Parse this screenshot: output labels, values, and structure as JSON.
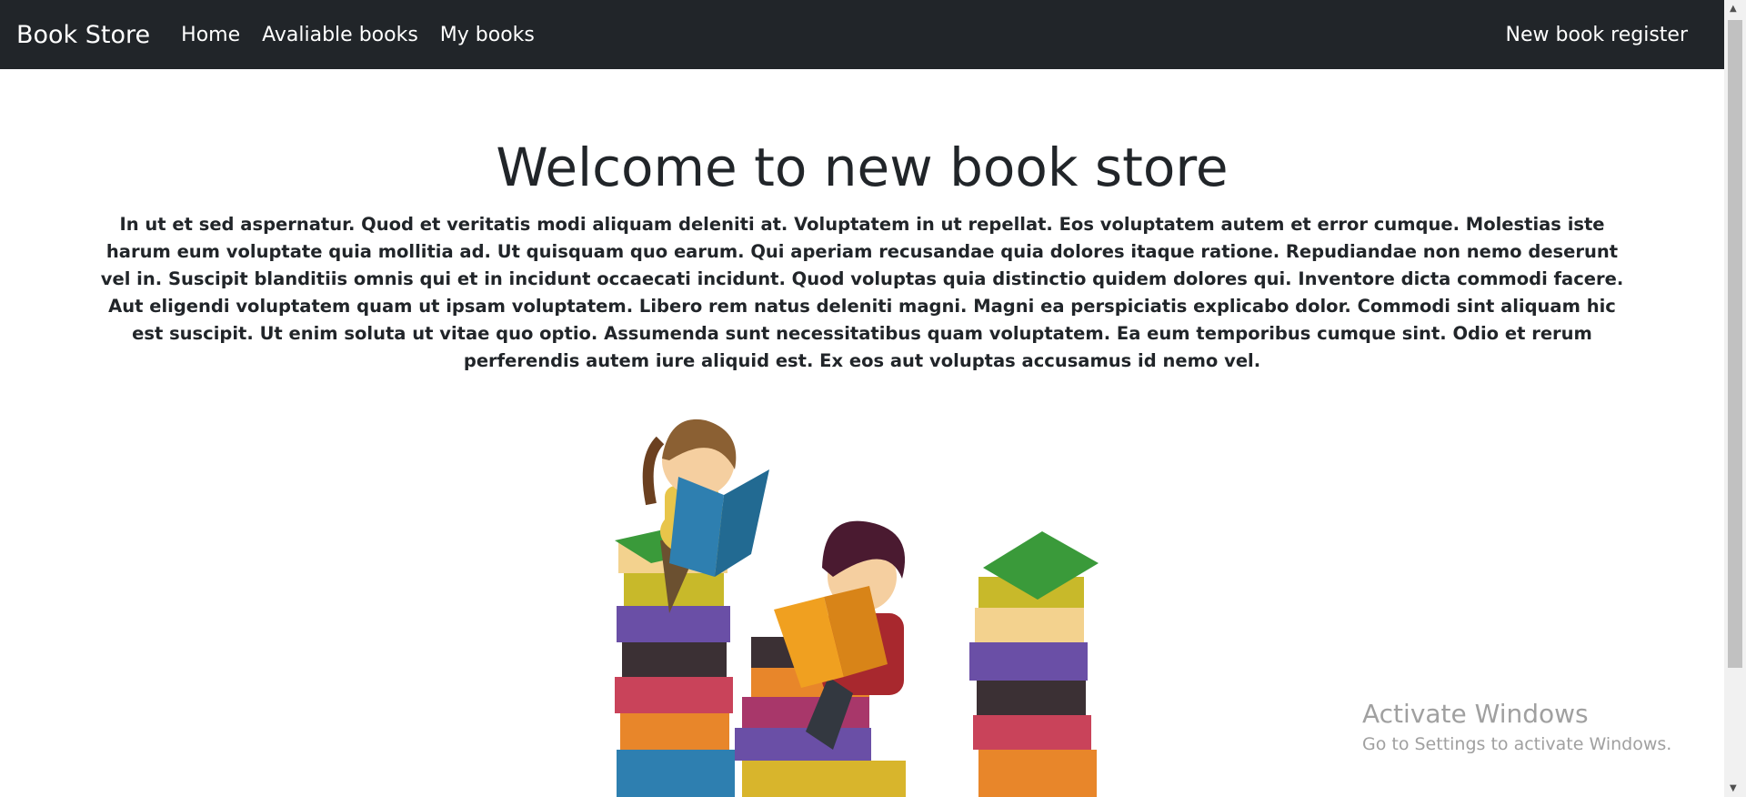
{
  "navbar": {
    "brand": "Book Store",
    "links": [
      {
        "label": "Home"
      },
      {
        "label": "Avaliable books"
      },
      {
        "label": "My books"
      }
    ],
    "register": "New book register"
  },
  "main": {
    "title": "Welcome to new book store",
    "paragraph": "In ut et sed aspernatur. Quod et veritatis modi aliquam deleniti at. Voluptatem in ut repellat. Eos voluptatem autem et error cumque. Molestias iste harum eum voluptate quia mollitia ad. Ut quisquam quo earum. Qui aperiam recusandae quia dolores itaque ratione. Repudiandae non nemo deserunt vel in. Suscipit blanditiis omnis qui et in incidunt occaecati incidunt. Quod voluptas quia distinctio quidem dolores qui. Inventore dicta commodi facere. Aut eligendi voluptatem quam ut ipsam voluptatem. Libero rem natus deleniti magni. Magni ea perspiciatis explicabo dolor. Commodi sint aliquam hic est suscipit. Ut enim soluta ut vitae quo optio. Assumenda sunt necessitatibus quam voluptatem. Ea eum temporibus cumque sint. Odio et rerum perferendis autem iure aliquid est. Ex eos aut voluptas accusamus id nemo vel."
  },
  "watermark": {
    "line1": "Activate Windows",
    "line2": "Go to Settings to activate Windows."
  },
  "colors": {
    "navbar": "#212529",
    "text": "#212529"
  }
}
